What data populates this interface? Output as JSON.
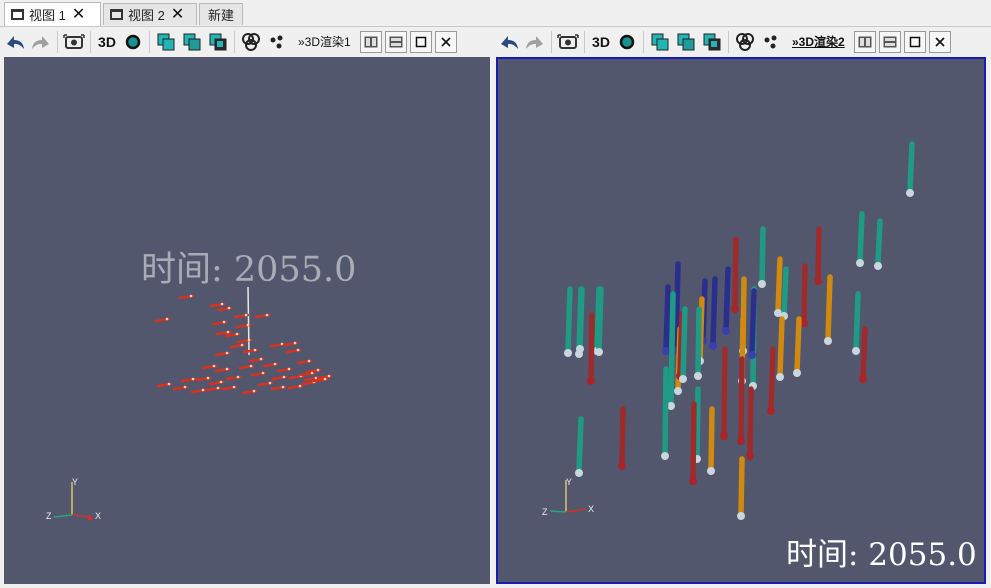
{
  "tabs": [
    {
      "label": "视图 1",
      "active": true
    },
    {
      "label": "视图 2",
      "active": false
    },
    {
      "label": "新建",
      "active": false
    }
  ],
  "views": [
    {
      "toolbar_3d_label": "3D",
      "view_name": "»3D渲染1",
      "time_text": "时间: 2055.0",
      "axes": {
        "x": "X",
        "y": "Y",
        "z": "Z"
      }
    },
    {
      "toolbar_3d_label": "3D",
      "view_name": "»3D渲染2",
      "time_text": "时间: 2055.0",
      "axes": {
        "x": "X",
        "y": "Y",
        "z": "Z"
      }
    }
  ],
  "colors": {
    "viewport_bg": "#52576e",
    "active_border": "#1a1ab4",
    "tube_red": "#9e2b2b",
    "tube_teal": "#1f9b85",
    "tube_orange": "#d08a10",
    "tube_blue": "#2a2f8e",
    "arrow_red": "#d8321e"
  },
  "icons": [
    "undo-camera-icon",
    "redo-camera-icon",
    "screenshot-icon",
    "3d-toggle-icon",
    "sphere-icon",
    "cube-icon",
    "cube-alt-icon",
    "cube-dark-icon",
    "venn-icon",
    "dots-icon",
    "split-horizontal-icon",
    "split-vertical-icon",
    "maximize-icon",
    "close-icon"
  ]
}
